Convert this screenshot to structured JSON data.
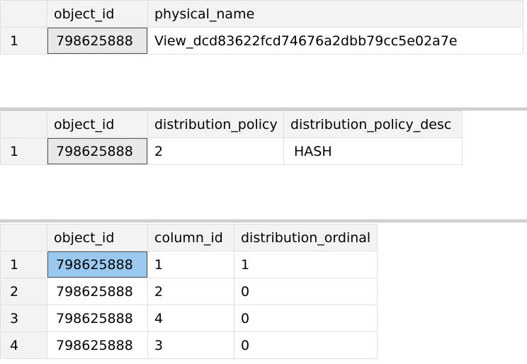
{
  "grid1": {
    "columns": [
      "object_id",
      "physical_name"
    ],
    "rows": [
      {
        "num": "1",
        "object_id": "798625888",
        "physical_name": "View_dcd83622fcd74676a2dbb79cc5e02a7e"
      }
    ]
  },
  "grid2": {
    "columns": [
      "object_id",
      "distribution_policy",
      "distribution_policy_desc"
    ],
    "rows": [
      {
        "num": "1",
        "object_id": "798625888",
        "distribution_policy": "2",
        "distribution_policy_desc": "HASH"
      }
    ]
  },
  "grid3": {
    "columns": [
      "object_id",
      "column_id",
      "distribution_ordinal"
    ],
    "rows": [
      {
        "num": "1",
        "object_id": "798625888",
        "column_id": "1",
        "distribution_ordinal": "1"
      },
      {
        "num": "2",
        "object_id": "798625888",
        "column_id": "2",
        "distribution_ordinal": "0"
      },
      {
        "num": "3",
        "object_id": "798625888",
        "column_id": "4",
        "distribution_ordinal": "0"
      },
      {
        "num": "4",
        "object_id": "798625888",
        "column_id": "3",
        "distribution_ordinal": "0"
      }
    ]
  },
  "colors": {
    "header_bg": "#f3f3f3",
    "selected_cell": "#99c9ef",
    "focused_cell": "#e8e8e8"
  }
}
